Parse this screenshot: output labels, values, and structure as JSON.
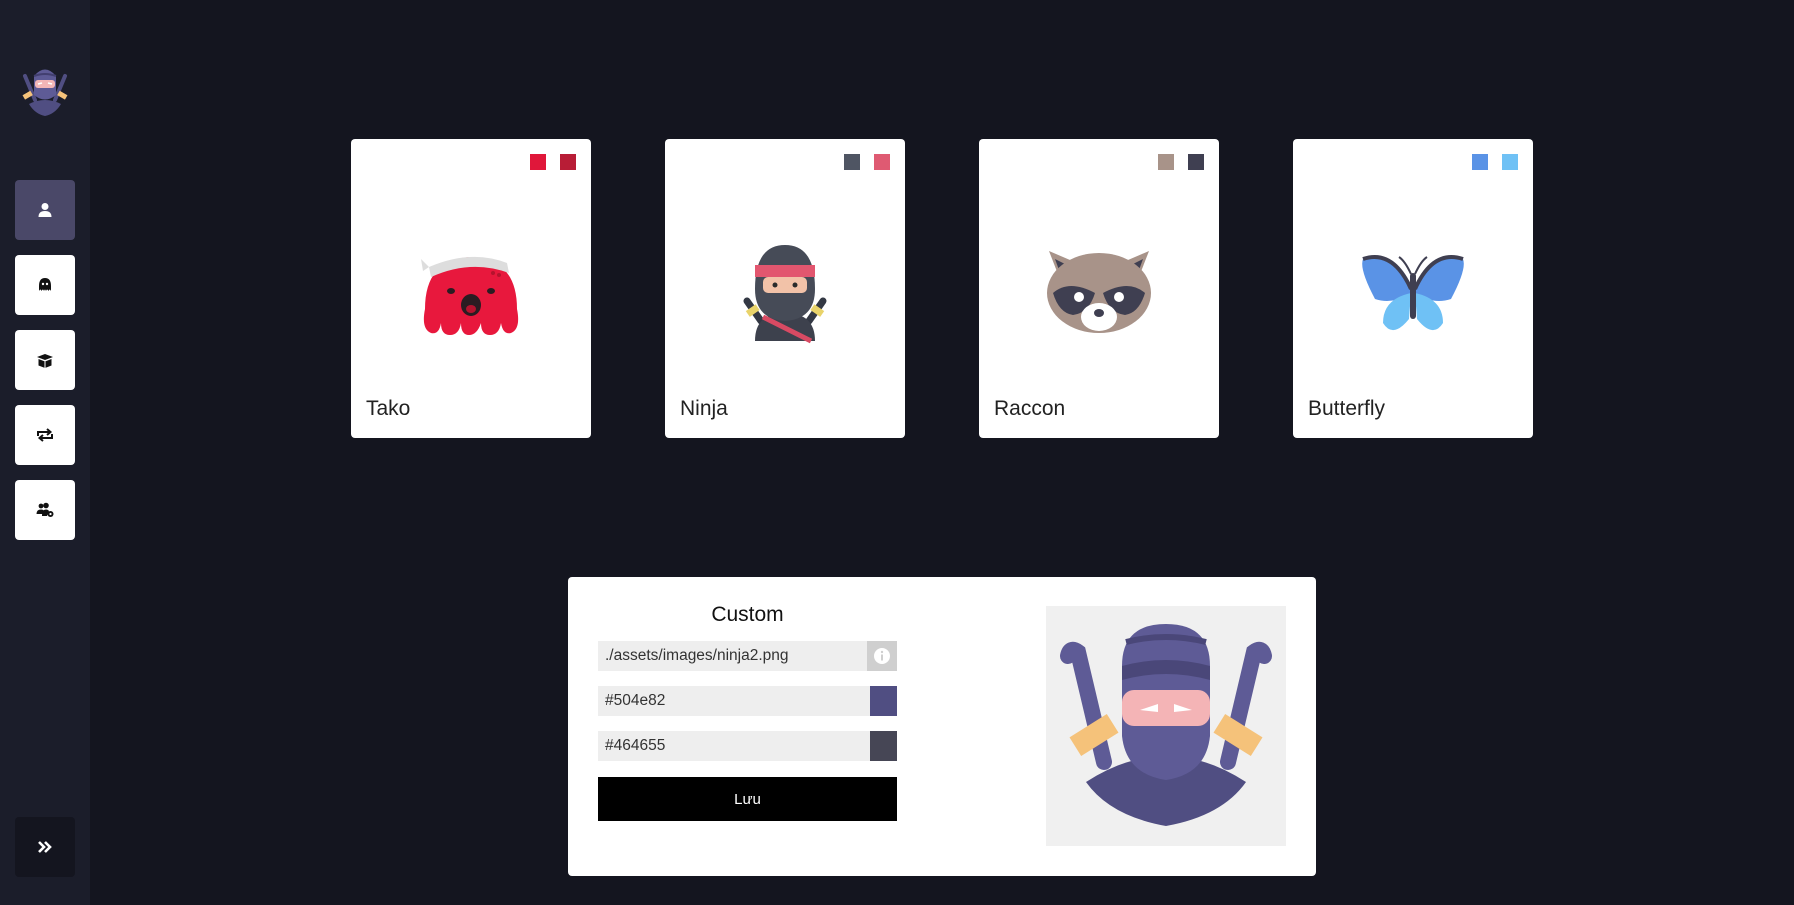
{
  "sidebar": {
    "items": [
      {
        "name": "profile",
        "icon": "user-icon",
        "active": true
      },
      {
        "name": "avatar",
        "icon": "octopus-icon",
        "active": false
      },
      {
        "name": "inventory",
        "icon": "box-icon",
        "active": false
      },
      {
        "name": "exchange",
        "icon": "repeat-icon",
        "active": false
      },
      {
        "name": "users-settings",
        "icon": "users-cog-icon",
        "active": false
      }
    ],
    "expand_icon": "double-chevron-right-icon"
  },
  "cards": [
    {
      "name": "Tako",
      "colors": [
        "#e0173a",
        "#b81d36"
      ],
      "icon": "octopus-image"
    },
    {
      "name": "Ninja",
      "colors": [
        "#4f5563",
        "#df5a72"
      ],
      "icon": "ninja-image"
    },
    {
      "name": "Raccon",
      "colors": [
        "#a89389",
        "#3f3f51"
      ],
      "icon": "raccoon-image"
    },
    {
      "name": "Butterfly",
      "colors": [
        "#5a93e6",
        "#6fc1f5"
      ],
      "icon": "butterfly-image"
    }
  ],
  "custom": {
    "title": "Custom",
    "image_path": "./assets/images/ninja2.png",
    "color1": "#504e82",
    "color2": "#464655",
    "save_label": "Lưu"
  }
}
